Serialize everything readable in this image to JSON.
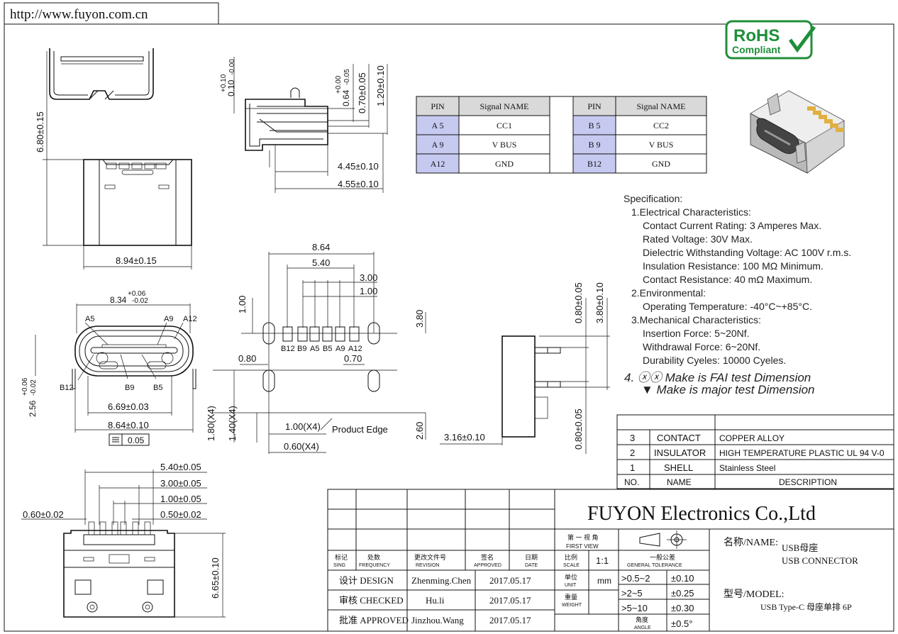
{
  "website": "http://www.fuyon.com.cn",
  "rohs": {
    "line1": "RoHS",
    "line2": "Compliant",
    "color": "#1f8f3a"
  },
  "pin_table": {
    "headers": [
      "PIN",
      "Signal NAME"
    ],
    "left": [
      [
        "A 5",
        "CC1"
      ],
      [
        "A 9",
        "V BUS"
      ],
      [
        "A12",
        "GND"
      ]
    ],
    "right": [
      [
        "B 5",
        "CC2"
      ],
      [
        "B 9",
        "V BUS"
      ],
      [
        "B12",
        "GND"
      ]
    ],
    "header_color": "#d9d9d9",
    "pin_color": "#c6c9f0"
  },
  "specification": {
    "title": "Specification:",
    "lines": [
      "1.Electrical Characteristics:",
      "Contact Current Rating: 3 Amperes Max.",
      "Rated Voltage:  30V Max.",
      "Dielectric Withstanding Voltage: AC 100V r.m.s.",
      "Insulation Resistance: 100 MΩ Minimum.",
      "Contact Resistance: 40 mΩ Maximum.",
      "2.Environmental:",
      "Operating Temperature: -40°C~+85°C.",
      "3.Mechanical Characteristics:",
      "Insertion Force: 5~20Nf.",
      "Withdrawal Force: 6~20Nf.",
      "Durability Cyeles: 10000 Cyeles."
    ],
    "note4": "4. ⓧⓧ Make  is  FAI  test  Dimension",
    "note5": "▼ Make  is  major  test  Dimension"
  },
  "dims": {
    "d680": "6.80±0.15",
    "d894": "8.94±0.15",
    "d010a": "+0.10",
    "d010b": "0.10",
    "d010c": "-0.00",
    "d064a": "+0.00",
    "d064b": "0.64",
    "d064c": "-0.05",
    "d070": "0.70±0.05",
    "d120": "1.20±0.10",
    "d445": "4.45±0.10",
    "d455": "4.55±0.10",
    "d006a": "+0.06",
    "d834": "8.34",
    "d002a": "-0.02",
    "d256": "2.56",
    "d669": "6.69±0.03",
    "d864b": "8.64±0.10",
    "flat": "0.05",
    "l864": "8.64",
    "l540": "5.40",
    "l300": "3.00",
    "l100": "1.00",
    "l100v": "1.00",
    "l380": "3.80",
    "l080": "0.80",
    "l070": "0.70",
    "l180": "1.80(X4)",
    "l140": "1.40(X4)",
    "l100x": "1.00(X4)",
    "l060x": "0.60(X4)",
    "l260": "2.60",
    "product_edge": "Product Edge",
    "s080a": "0.80±0.05",
    "s380": "3.80±0.10",
    "s080b": "0.80±0.05",
    "s316": "3.16±0.10",
    "b540": "5.40±0.05",
    "b300": "3.00±0.05",
    "b100": "1.00±0.05",
    "b050": "0.50±0.02",
    "b060": "0.60±0.02",
    "b665": "6.65±0.10"
  },
  "pin_labels_front": [
    "A5",
    "A9",
    "A12",
    "B12",
    "B9",
    "B5"
  ],
  "pin_labels_pad": [
    "B12",
    "B9",
    "A5",
    "B5",
    "A9",
    "A12"
  ],
  "bom": {
    "rows": [
      [
        "3",
        "CONTACT",
        "COPPER  ALLOY"
      ],
      [
        "2",
        "INSULATOR",
        "HIGH  TEMPERATURE  PLASTIC  UL  94  V-0"
      ],
      [
        "1",
        "SHELL",
        "Stainless  Steel"
      ]
    ],
    "header": [
      "NO.",
      "NAME",
      "DESCRIPTION"
    ]
  },
  "title_block": {
    "company": "FUYON Electronics Co.,Ltd",
    "first_view_cn": "第 一 视 角",
    "first_view_en": "FIRST VIEW",
    "cols": [
      [
        "标记",
        "SING"
      ],
      [
        "处数",
        "FREQUENCY"
      ],
      [
        "更改文件号",
        "REVISION"
      ],
      [
        "签名",
        "APPROVED"
      ],
      [
        "日期",
        "DATE"
      ]
    ],
    "scale_cn": "比例",
    "scale_en": "SCALE",
    "scale": "1:1",
    "tol_cn": "一般公差",
    "tol_en": "GENERAL TOLERANCE",
    "unit_cn": "单位",
    "unit_en": "UNIT",
    "unit": "mm",
    "weight_cn": "重量",
    "weight_en": "WEIGHT",
    "angle_cn": "角度",
    "angle_en": "ANGLE",
    "tolerances": [
      [
        ">0.5~2",
        "±0.10"
      ],
      [
        ">2~5",
        "±0.25"
      ],
      [
        ">5~10",
        "±0.30"
      ],
      [
        "",
        "±0.5°"
      ]
    ],
    "people": [
      [
        "设计  DESIGN",
        "Zhenming.Chen",
        "2017.05.17"
      ],
      [
        "审核  CHECKED",
        "Hu.li",
        "2017.05.17"
      ],
      [
        "批准  APPROVED",
        "Jinzhou.Wang",
        "2017.05.17"
      ]
    ],
    "name_label": "名称/NAME:",
    "name_cn": "USB母座",
    "name_en": "USB  CONNECTOR",
    "model_label": "型号/MODEL:",
    "model": "USB  Type-C 母座单排 6P"
  }
}
